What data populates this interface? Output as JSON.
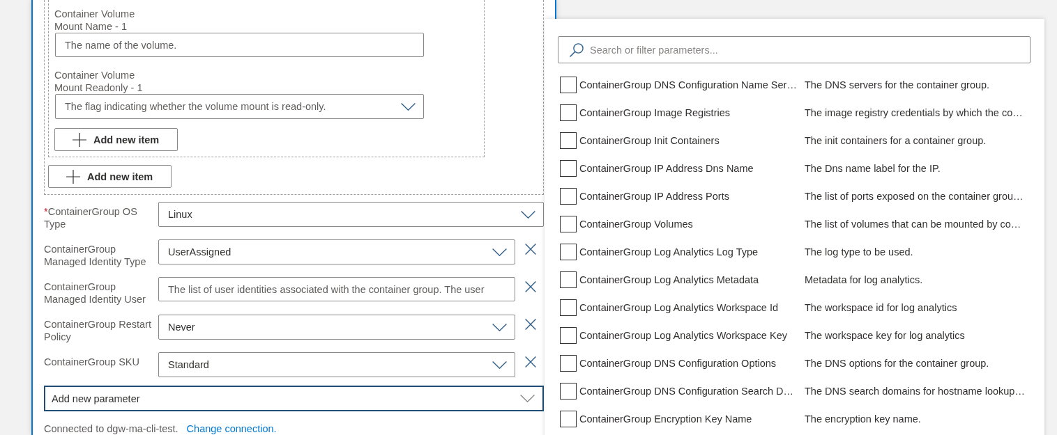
{
  "editor": {
    "array_group": {
      "item_group": {
        "fields": [
          {
            "kind": "text",
            "label": "Container Volume Mount Name - 1",
            "placeholder": "The name of the volume."
          },
          {
            "kind": "dropdown",
            "label": "Container Volume Mount Readonly - 1",
            "placeholder": "The flag indicating whether the volume mount is read-only."
          }
        ],
        "add_button": "Add new item"
      },
      "add_button": "Add new item"
    },
    "parameters": [
      {
        "kind": "dropdown",
        "required_mark": "*",
        "label": "ContainerGroup OS Type",
        "value": "Linux",
        "removable": false
      },
      {
        "kind": "dropdown",
        "label": "ContainerGroup Managed Identity Type",
        "value": "UserAssigned",
        "removable": true
      },
      {
        "kind": "text",
        "label": "ContainerGroup Managed Identity User",
        "placeholder": "The list of user identities associated with the container group. The user",
        "removable": true
      },
      {
        "kind": "dropdown",
        "label": "ContainerGroup Restart Policy",
        "value": "Never",
        "removable": true
      },
      {
        "kind": "dropdown",
        "label": "ContainerGroup SKU",
        "value": "Standard",
        "removable": true
      }
    ],
    "add_parameter": {
      "label": "Add new parameter",
      "expanded": true
    },
    "connection": {
      "status": "Connected to dgw-ma-cli-test.",
      "link": "Change connection."
    }
  },
  "parameter_picker": {
    "search": {
      "placeholder": "Search or filter parameters..."
    },
    "items": [
      {
        "name": "ContainerGroup DNS Configuration Name Ser…",
        "description": "The DNS servers for the container group.",
        "checked": false
      },
      {
        "name": "ContainerGroup Image Registries",
        "description": "The image registry credentials by which the co…",
        "checked": false
      },
      {
        "name": "ContainerGroup Init Containers",
        "description": "The init containers for a container group.",
        "checked": false
      },
      {
        "name": "ContainerGroup IP Address Dns Name",
        "description": "The Dns name label for the IP.",
        "checked": false
      },
      {
        "name": "ContainerGroup IP Address Ports",
        "description": "The list of ports exposed on the container grou…",
        "checked": false
      },
      {
        "name": "ContainerGroup Volumes",
        "description": "The list of volumes that can be mounted by co…",
        "checked": false
      },
      {
        "name": "ContainerGroup Log Analytics Log Type",
        "description": "The log type to be used.",
        "checked": false
      },
      {
        "name": "ContainerGroup Log Analytics Metadata",
        "description": "Metadata for log analytics.",
        "checked": false
      },
      {
        "name": "ContainerGroup Log Analytics Workspace Id",
        "description": "The workspace id for log analytics",
        "checked": false
      },
      {
        "name": "ContainerGroup Log Analytics Workspace Key",
        "description": "The workspace key for log analytics",
        "checked": false
      },
      {
        "name": "ContainerGroup DNS Configuration Options",
        "description": "The DNS options for the container group.",
        "checked": false
      },
      {
        "name": "ContainerGroup DNS Configuration Search D…",
        "description": "The DNS search domains for hostname lookup…",
        "checked": false
      },
      {
        "name": "ContainerGroup Encryption Key Name",
        "description": "The encryption key name.",
        "checked": false
      }
    ]
  }
}
